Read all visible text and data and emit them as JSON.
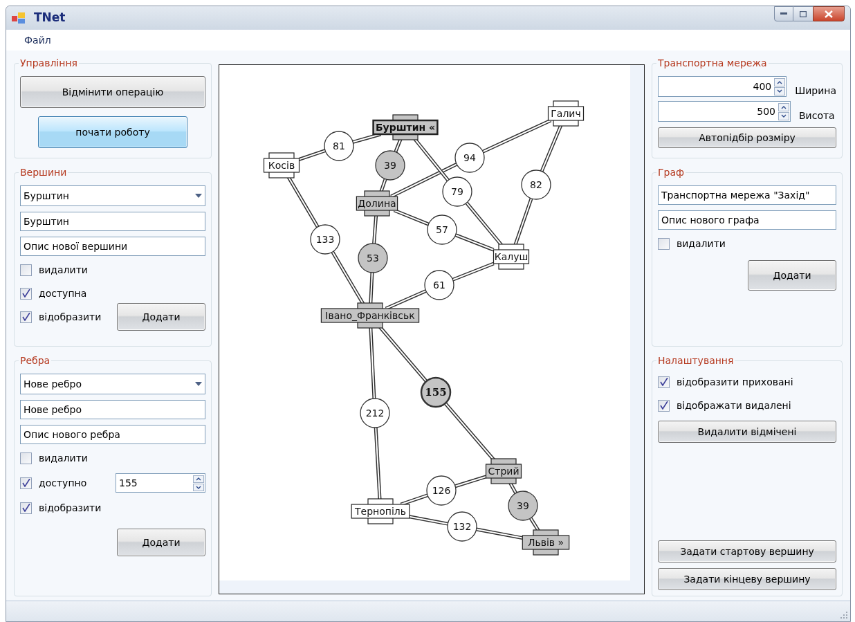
{
  "window": {
    "title": "TNet"
  },
  "menu": [
    {
      "label": "Файл"
    }
  ],
  "control_panel": {
    "title": "Управління",
    "buttons": [
      {
        "label": "Відмінити операцію",
        "kind": "normal"
      },
      {
        "label": "почати роботу",
        "kind": "primary"
      }
    ]
  },
  "vertices": {
    "title": "Вершини",
    "dropdown": "Бурштин",
    "name": "Бурштин",
    "description": "Опис нової вершини",
    "checkboxes": [
      {
        "label": "видалити",
        "checked": false
      },
      {
        "label": "доступна",
        "checked": true
      },
      {
        "label": "відобразити",
        "checked": true
      }
    ],
    "add_button": "Додати"
  },
  "edges": {
    "title": "Ребра",
    "dropdown": "Нове ребро",
    "name": "Нове ребро",
    "description": "Опис нового ребра",
    "checkboxes": [
      {
        "label": "видалити",
        "checked": false
      },
      {
        "label": "доступно",
        "checked": true
      },
      {
        "label": "відобразити",
        "checked": true
      }
    ],
    "weight": "155",
    "add_button": "Додати"
  },
  "graph": {
    "nodes": [
      {
        "label": "Бурштин «",
        "highlighted": true,
        "selected": true
      },
      {
        "label": "Галич",
        "highlighted": false,
        "selected": false
      },
      {
        "label": "Косів",
        "highlighted": false,
        "selected": false
      },
      {
        "label": "Долина",
        "highlighted": true,
        "selected": false
      },
      {
        "label": "Калуш",
        "highlighted": false,
        "selected": false
      },
      {
        "label": "Івано_Франківськ",
        "highlighted": true,
        "selected": false
      },
      {
        "label": "Стрий",
        "highlighted": true,
        "selected": false
      },
      {
        "label": "Тернопіль",
        "highlighted": false,
        "selected": false
      },
      {
        "label": "Львів »",
        "highlighted": true,
        "selected": false
      }
    ],
    "edges": [
      {
        "weight": "81",
        "highlighted": false,
        "selected": false
      },
      {
        "weight": "39",
        "highlighted": true,
        "selected": false
      },
      {
        "weight": "94",
        "highlighted": false,
        "selected": false
      },
      {
        "weight": "79",
        "highlighted": false,
        "selected": false
      },
      {
        "weight": "82",
        "highlighted": false,
        "selected": false
      },
      {
        "weight": "57",
        "highlighted": false,
        "selected": false
      },
      {
        "weight": "133",
        "highlighted": false,
        "selected": false
      },
      {
        "weight": "53",
        "highlighted": true,
        "selected": false
      },
      {
        "weight": "61",
        "highlighted": false,
        "selected": false
      },
      {
        "weight": "155",
        "highlighted": true,
        "selected": true
      },
      {
        "weight": "212",
        "highlighted": false,
        "selected": false
      },
      {
        "weight": "126",
        "highlighted": false,
        "selected": false
      },
      {
        "weight": "39",
        "highlighted": true,
        "selected": false
      },
      {
        "weight": "132",
        "highlighted": false,
        "selected": false
      }
    ]
  },
  "network": {
    "title": "Транспортна мережа",
    "width": {
      "value": "400",
      "label": "Ширина"
    },
    "height": {
      "value": "500",
      "label": "Висота"
    },
    "autosize_button": "Автопідбір розміру"
  },
  "graph_panel": {
    "title": "Граф",
    "name": "Транспортна мережа \"Захід\"",
    "description": "Опис нового графа",
    "checkboxes": [
      {
        "label": "видалити",
        "checked": false
      }
    ],
    "add_button": "Додати"
  },
  "settings": {
    "title": "Налаштування",
    "checkboxes": [
      {
        "label": "відобразити приховані",
        "checked": true
      },
      {
        "label": "відображати видалені",
        "checked": true
      }
    ],
    "delete_button": "Видалити відмічені",
    "start_button": "Задати стартову вершину",
    "end_button": "Задати кінцеву вершину"
  }
}
